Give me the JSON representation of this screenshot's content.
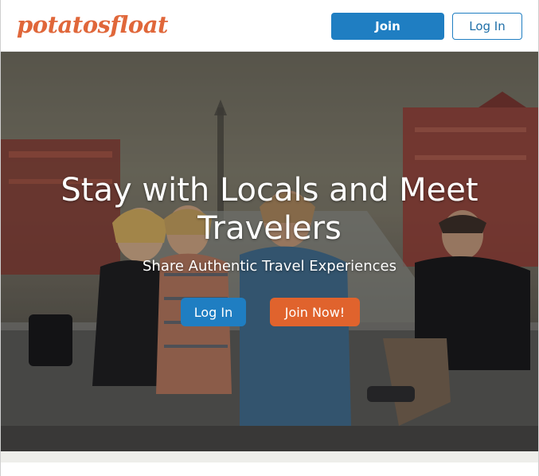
{
  "header": {
    "logo_text": "potatosfloat",
    "join_label": "Join",
    "login_label": "Log In"
  },
  "hero": {
    "title": "Stay with Locals and Meet Travelers",
    "subtitle": "Share Authentic Travel Experiences",
    "login_label": "Log In",
    "join_label": "Join Now!"
  },
  "colors": {
    "brand_orange": "#e0673a",
    "primary_blue": "#1f7ec2",
    "cta_orange": "#e0632d"
  }
}
